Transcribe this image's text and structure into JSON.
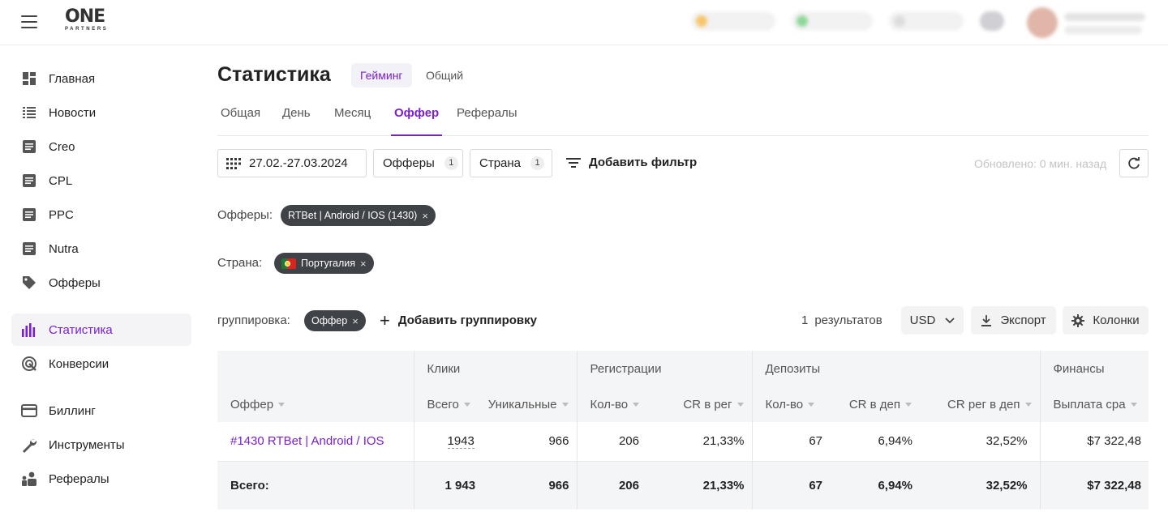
{
  "logo": {
    "big": "ONE",
    "small": "PARTNERS"
  },
  "sidebar": {
    "items": [
      {
        "label": "Главная",
        "icon": "dashboard-icon"
      },
      {
        "label": "Новости",
        "icon": "list-icon"
      },
      {
        "label": "Creo",
        "icon": "document-icon"
      },
      {
        "label": "CPL",
        "icon": "document-icon"
      },
      {
        "label": "PPC",
        "icon": "document-icon"
      },
      {
        "label": "Nutra",
        "icon": "document-icon"
      },
      {
        "label": "Офферы",
        "icon": "tag-icon"
      },
      {
        "label": "Статистика",
        "icon": "bar-chart-icon",
        "active": true
      },
      {
        "label": "Конверсии",
        "icon": "target-icon"
      },
      {
        "label": "Биллинг",
        "icon": "credit-card-icon"
      },
      {
        "label": "Инструменты",
        "icon": "wrench-icon"
      },
      {
        "label": "Рефералы",
        "icon": "referrals-icon"
      }
    ]
  },
  "header": {
    "title": "Статистика",
    "segments": [
      "Гейминг",
      "Общий"
    ]
  },
  "tabs": [
    "Общая",
    "День",
    "Месяц",
    "Оффер",
    "Рефералы"
  ],
  "filters": {
    "date_range": "27.02.-27.03.2024",
    "offers_label": "Офферы",
    "offers_count": "1",
    "country_label": "Страна",
    "country_count": "1",
    "add_filter": "Добавить фильтр",
    "updated": "Обновлено: 0 мин. назад"
  },
  "active_filters": {
    "offers_label": "Офферы:",
    "offer_chip": "RTBet | Android / IOS (1430)",
    "country_label": "Страна:",
    "country_chip": "Португалия"
  },
  "grouping": {
    "label": "группировка:",
    "chip": "Оффер",
    "add": "Добавить группировку",
    "results_count": "1",
    "results_label": "результатов",
    "currency": "USD",
    "export": "Экспорт",
    "columns": "Колонки"
  },
  "table": {
    "groups": [
      "Клики",
      "Регистрации",
      "Депозиты",
      "Финансы"
    ],
    "columns": [
      "Оффер",
      "Всего",
      "Уникальные",
      "Кол-во",
      "CR в рег",
      "Кол-во",
      "CR в деп",
      "CR рег в деп",
      "Выплата cpa"
    ],
    "rows": [
      [
        "#1430 RTBet | Android / IOS",
        "1943",
        "966",
        "206",
        "21,33%",
        "67",
        "6,94%",
        "32,52%",
        "$7 322,48"
      ]
    ],
    "total": [
      "Всего:",
      "1 943",
      "966",
      "206",
      "21,33%",
      "67",
      "6,94%",
      "32,52%",
      "$7 322,48"
    ]
  },
  "colors": {
    "accent": "#7a1fd1",
    "chip": "#3f4247",
    "positive": "#3c9a4a"
  }
}
